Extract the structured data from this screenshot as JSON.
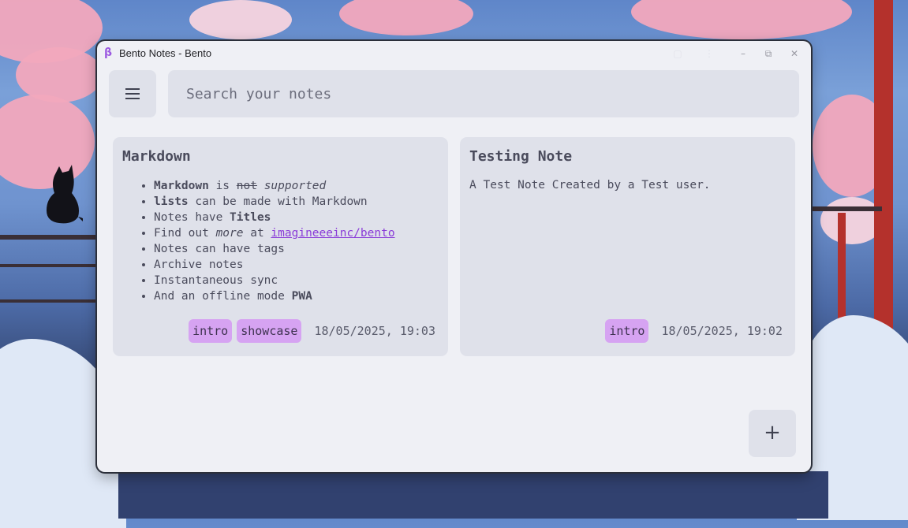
{
  "window": {
    "title": "Bento Notes - Bento",
    "app_icon": "β"
  },
  "window_controls": [
    "–",
    "⧉",
    "✕"
  ],
  "search": {
    "placeholder": "Search your notes"
  },
  "notes": [
    {
      "title": "Markdown",
      "items": [
        {
          "parts": [
            "Markdown",
            " is ",
            "not",
            " ",
            "supported"
          ]
        },
        {
          "parts": [
            "lists",
            " can be made with Markdown"
          ]
        },
        {
          "parts": [
            "Notes have ",
            "Titles"
          ]
        },
        {
          "parts": [
            "Find out ",
            "more",
            " at ",
            "imagineeeinc/bento"
          ]
        },
        {
          "parts": [
            "Notes can have tags"
          ]
        },
        {
          "parts": [
            "Archive notes"
          ]
        },
        {
          "parts": [
            "Instantaneous sync"
          ]
        },
        {
          "parts": [
            "And an offline mode ",
            "PWA"
          ]
        }
      ],
      "tags": [
        "intro",
        "showcase"
      ],
      "date": "18/05/2025, 19:03"
    },
    {
      "title": "Testing Note",
      "body": "A Test Note Created by a Test user.",
      "tags": [
        "intro"
      ],
      "date": "18/05/2025, 19:02"
    }
  ],
  "fab": {
    "label": "+"
  },
  "colors": {
    "accent": "#9b59e0",
    "tag_bg": "#d6a3f2",
    "card_bg": "#dfe1ea",
    "window_bg": "#eff0f5"
  },
  "icons": {
    "menu": "hamburger-icon",
    "add": "plus-icon",
    "minimize": "minimize-icon",
    "maximize": "maximize-icon",
    "close": "close-icon"
  }
}
